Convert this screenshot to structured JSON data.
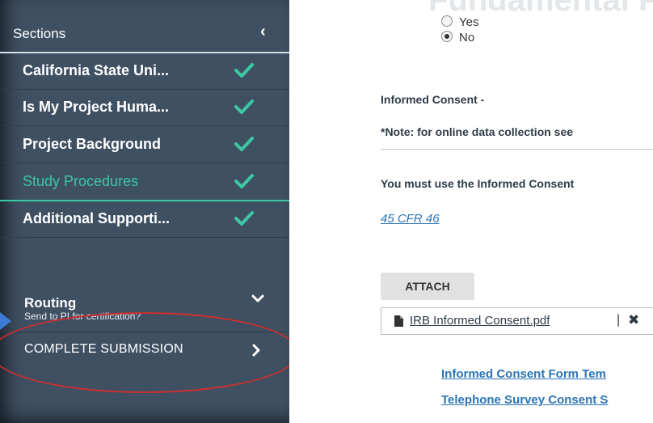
{
  "sidebar": {
    "title": "Sections",
    "sections": [
      {
        "label": "California State Uni...",
        "status": "complete"
      },
      {
        "label": "Is My Project Huma...",
        "status": "complete"
      },
      {
        "label": "Project Background",
        "status": "complete"
      },
      {
        "label": "Study Procedures",
        "status": "complete",
        "active": true
      },
      {
        "label": "Additional Supporti...",
        "status": "complete"
      }
    ],
    "routing": {
      "label": "Routing",
      "subtext": "Send to PI for certification?"
    },
    "complete_submission": {
      "label": "COMPLETE SUBMISSION"
    }
  },
  "main": {
    "faded_heading": "Fundamental Frequency and G",
    "radio_options": [
      {
        "label": "Yes",
        "checked": false
      },
      {
        "label": "No",
        "checked": true
      }
    ],
    "informed_consent_heading": "Informed Consent -",
    "note": "*Note: for online data collection see",
    "must_use": "You must use the Informed Consent",
    "cfr_link": "45 CFR 46",
    "attach_button": "ATTACH",
    "attached_file": {
      "name": "IRB Informed Consent.pdf",
      "separator": "|"
    },
    "links": [
      "Informed Consent Form Tem",
      "Telephone Survey Consent S"
    ]
  },
  "colors": {
    "sidebar_bg": "#3f5063",
    "accent_green": "#3cc8a4",
    "link_blue": "#2b74b6",
    "annotation_red": "#cc2e2e"
  }
}
